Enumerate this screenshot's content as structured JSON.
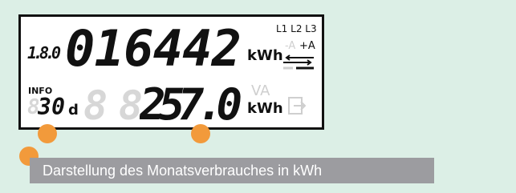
{
  "colors": {
    "background": "#dcefe6",
    "lcd_active": "#111111",
    "lcd_ghost": "#d7d7d7",
    "marker": "#f29a3b",
    "caption_bg": "#9c9ca0"
  },
  "display": {
    "obis_code": "1.8.0",
    "top_reading": "016442",
    "top_unit": "kWh",
    "phases": "L1 L2 L3",
    "direction_minus": "-A",
    "direction_plus": "+A",
    "info_label": "INFO",
    "period_value": "30",
    "period_unit": "d",
    "bottom_reading": "257.0",
    "bottom_unit_ghost": "VA",
    "bottom_unit": "kWh"
  },
  "caption": "Darstellung des Monatsverbrauches in kWh"
}
